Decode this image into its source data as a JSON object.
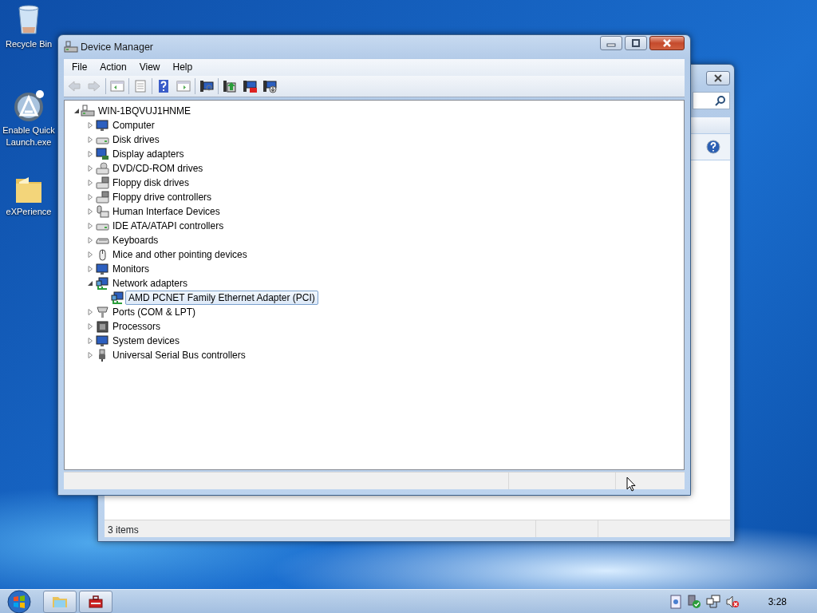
{
  "desktop_icons": [
    {
      "label": "Recycle Bin"
    },
    {
      "label": "Enable Quick Launch.exe"
    },
    {
      "label": "eXPerience"
    }
  ],
  "back_window": {
    "status_bar": "3 items"
  },
  "window": {
    "title": "Device Manager",
    "menu": [
      "File",
      "Action",
      "View",
      "Help"
    ],
    "toolbar_groups": [
      [
        {
          "disabled": true
        },
        {
          "disabled": true
        }
      ],
      [
        {
          "disabled": false
        }
      ],
      [
        {
          "disabled": false
        }
      ],
      [
        {
          "disabled": false
        },
        {
          "disabled": false
        }
      ],
      [
        {
          "disabled": false
        }
      ],
      [
        {
          "disabled": false
        },
        {
          "disabled": false
        },
        {
          "disabled": false
        }
      ]
    ],
    "tree": {
      "label": "WIN-1BQVUJ1HNME",
      "expanded": true,
      "children": [
        {
          "label": "Computer",
          "expanded": false,
          "selected": false
        },
        {
          "label": "Disk drives",
          "expanded": false,
          "selected": false
        },
        {
          "label": "Display adapters",
          "expanded": false,
          "selected": false
        },
        {
          "label": "DVD/CD-ROM drives",
          "expanded": false,
          "selected": false
        },
        {
          "label": "Floppy disk drives",
          "expanded": false,
          "selected": false
        },
        {
          "label": "Floppy drive controllers",
          "expanded": false,
          "selected": false
        },
        {
          "label": "Human Interface Devices",
          "expanded": false,
          "selected": false
        },
        {
          "label": "IDE ATA/ATAPI controllers",
          "expanded": false,
          "selected": false
        },
        {
          "label": "Keyboards",
          "expanded": false,
          "selected": false
        },
        {
          "label": "Mice and other pointing devices",
          "expanded": false,
          "selected": false
        },
        {
          "label": "Monitors",
          "expanded": false,
          "selected": false
        },
        {
          "label": "Network adapters",
          "expanded": true,
          "selected": false,
          "children": [
            {
              "label": "AMD PCNET Family Ethernet Adapter (PCI)",
              "selected": true
            }
          ]
        },
        {
          "label": "Ports (COM & LPT)",
          "expanded": false,
          "selected": false
        },
        {
          "label": "Processors",
          "expanded": false,
          "selected": false
        },
        {
          "label": "System devices",
          "expanded": false,
          "selected": false
        },
        {
          "label": "Universal Serial Bus controllers",
          "expanded": false,
          "selected": false
        }
      ]
    }
  },
  "taskbar": {
    "clock": "3:28"
  }
}
